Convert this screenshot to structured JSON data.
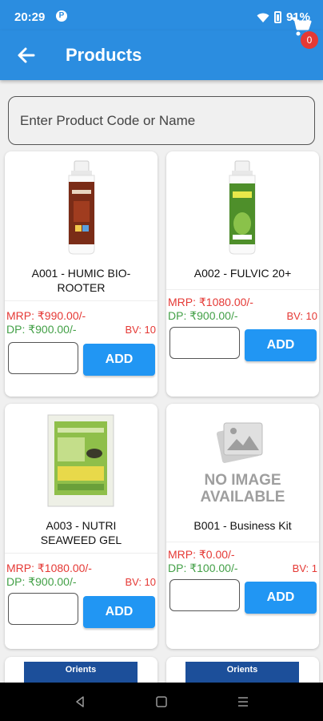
{
  "status_bar": {
    "time": "20:29",
    "app_icon_letter": "P",
    "battery": "91%"
  },
  "app_bar": {
    "title": "Products",
    "cart_count": "0"
  },
  "search": {
    "placeholder": "Enter Product Code or Name",
    "value": ""
  },
  "products": [
    {
      "name": "A001 - HUMIC BIO-ROOTER",
      "mrp": "MRP: ₹990.00/-",
      "dp": "DP: ₹900.00/-",
      "bv": "BV: 10",
      "add_label": "ADD",
      "image": "humic-bottle"
    },
    {
      "name": "A002 - FULVIC 20+",
      "mrp": "MRP: ₹1080.00/-",
      "dp": "DP: ₹900.00/-",
      "bv": "BV: 10",
      "add_label": "ADD",
      "image": "fulvic-bottle"
    },
    {
      "name": "A003 - NUTRI SEAWEED GEL",
      "mrp": "MRP: ₹1080.00/-",
      "dp": "DP: ₹900.00/-",
      "bv": "BV: 10",
      "add_label": "ADD",
      "image": "seaweed-pouch"
    },
    {
      "name": "B001 - Business Kit",
      "mrp": "MRP: ₹0.00/-",
      "dp": "DP: ₹100.00/-",
      "bv": "BV: 1",
      "add_label": "ADD",
      "image": "no-image",
      "no_image_line1": "NO IMAGE",
      "no_image_line2": "AVAILABLE"
    }
  ],
  "partial_cards": [
    {
      "banner_text": "Orients"
    },
    {
      "banner_text": "Orients"
    }
  ],
  "colors": {
    "primary": "#2b8de0",
    "button": "#2196f3",
    "mrp": "#e53935",
    "dp": "#43a047",
    "badge": "#e53935"
  }
}
